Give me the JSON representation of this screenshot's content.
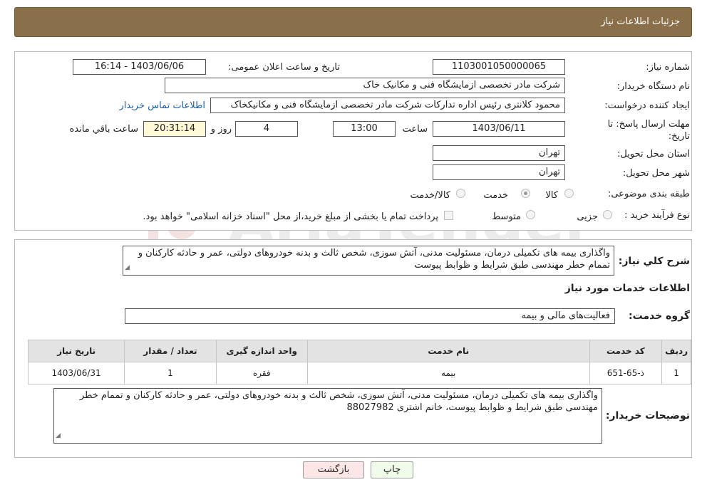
{
  "header": {
    "title": "جزئیات اطلاعات نیاز"
  },
  "watermark": {
    "text": "AriaTender.neT"
  },
  "form": {
    "need_number": {
      "label": "شماره نیاز:",
      "value": "1103001050000065"
    },
    "announce": {
      "label": "تاریخ و ساعت اعلان عمومی:",
      "value": "1403/06/06 - 16:14"
    },
    "buyer_org": {
      "label": "نام دستگاه خریدار:",
      "value": "شرکت مادر تخصصی ازمایشگاه فنی و مکانیک خاک"
    },
    "creator": {
      "label": "ایجاد کننده درخواست:",
      "value": "محمود کلانتری رئیس اداره تدارکات شرکت مادر تخصصی ازمایشگاه فنی و مکانیکخاک",
      "contact_link": "اطلاعات تماس خریدار"
    },
    "deadline": {
      "label": "مهلت ارسال پاسخ: تا تاریخ:",
      "date": "1403/06/11",
      "time_label": "ساعت",
      "time": "13:00",
      "days": "4",
      "days_label": "روز و",
      "remaining": "20:31:14",
      "remaining_label": "ساعت باقي مانده"
    },
    "province": {
      "label": "استان محل تحویل:",
      "value": "تهران"
    },
    "city": {
      "label": "شهر محل تحویل:",
      "value": "تهران"
    },
    "category": {
      "label": "طبقه بندی موضوعی:",
      "options": [
        "کالا",
        "خدمت",
        "کالا/خدمت"
      ],
      "selected": "خدمت"
    },
    "process": {
      "label": "نوع فرآیند خرید :",
      "options": [
        "جزیی",
        "متوسط"
      ],
      "note": "پرداخت تمام یا بخشی از مبلغ خرید،از محل \"اسناد خزانه اسلامی\" خواهد بود."
    }
  },
  "description": {
    "label": "شرح کلي نياز:",
    "text": "واگذاری بیمه های تکمیلی درمان، مسئولیت مدنی، آتش سوزی، شخص ثالث و بدنه خودروهای دولتی، عمر و حادثه کارکنان و تممام خطر مهندسی طبق شرایط و ظوابط پیوست"
  },
  "services": {
    "section_title": "اطلاعات خدمات مورد نیاز",
    "group_label": "گروه خدمت:",
    "group_value": "فعالیت‌های مالی و بیمه",
    "columns": [
      "ردیف",
      "کد خدمت",
      "نام خدمت",
      "واحد اندازه گیری",
      "تعداد / مقدار",
      "تاریخ نیاز"
    ],
    "rows": [
      [
        "1",
        "ذ-65-651",
        "بیمه",
        "فقره",
        "1",
        "1403/06/31"
      ]
    ]
  },
  "buyer_notes": {
    "label": "توضیحات خریدار:",
    "text": "واگذاری بیمه های تکمیلی درمان، مسئولیت مدنی، آتش سوزی، شخص ثالث و بدنه خودروهای دولتی، عمر و حادثه کارکنان و تممام خطر مهندسی طبق شرایط و ظوابط پیوست، خانم اشتری 88027982"
  },
  "buttons": {
    "print": "چاپ",
    "back": "بازگشت"
  }
}
